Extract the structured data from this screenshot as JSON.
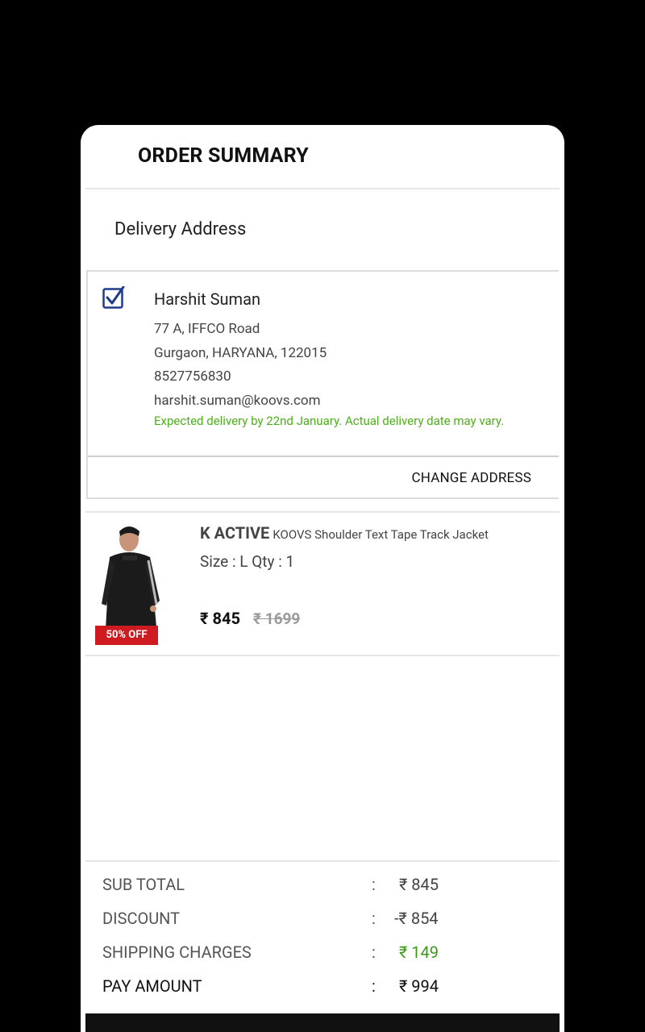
{
  "header": {
    "title": "ORDER SUMMARY"
  },
  "delivery": {
    "section_label": "Delivery Address",
    "name": "Harshit Suman",
    "line1": "77 A, IFFCO Road",
    "line2": "Gurgaon, HARYANA, 122015",
    "phone": "8527756830",
    "email": "harshit.suman@koovs.com",
    "expected_note": "Expected delivery by 22nd January. Actual delivery date may vary.",
    "change_label": "CHANGE ADDRESS",
    "checked": true
  },
  "product": {
    "brand": "K ACTIVE",
    "name": "KOOVS Shoulder Text Tape Track Jacket",
    "size_qty": "Size : L  Qty : 1",
    "price": "₹ 845",
    "mrp": "₹ 1699",
    "discount_badge": "50% OFF"
  },
  "summary": {
    "rows": [
      {
        "label": "SUB TOTAL",
        "colon": ":",
        "value": "₹ 845"
      },
      {
        "label": "DISCOUNT",
        "colon": ":",
        "value": "-₹ 854"
      },
      {
        "label": "SHIPPING CHARGES",
        "colon": ":",
        "value": "₹ 149"
      },
      {
        "label": "PAY AMOUNT",
        "colon": ":",
        "value": "₹ 994"
      }
    ]
  },
  "colors": {
    "accent_green": "#4caf1a",
    "badge_red": "#cd1b21",
    "checkbox_blue": "#1f3b8c"
  }
}
